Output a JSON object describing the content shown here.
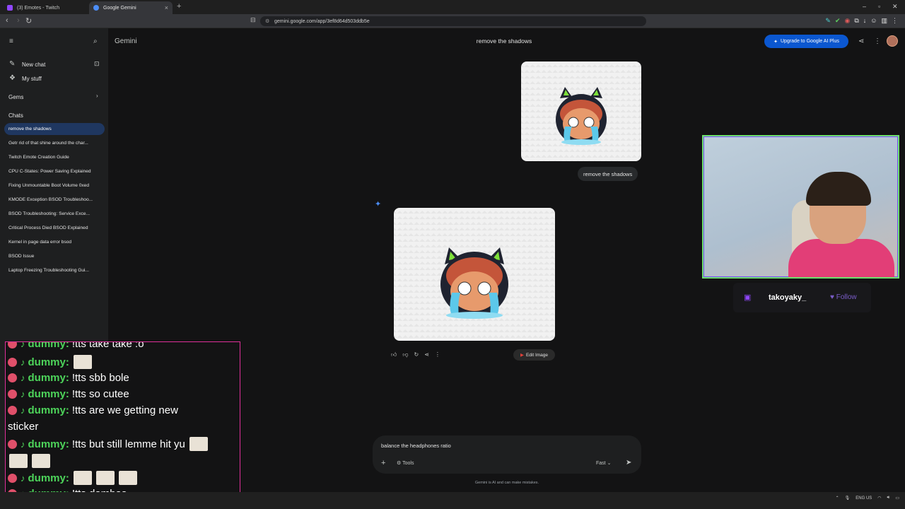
{
  "browser": {
    "tabs": [
      {
        "label": "(3) Emotes - Twitch",
        "active": false
      },
      {
        "label": "Google Gemini",
        "active": true
      }
    ],
    "url": "gemini.google.com/app/3ef8d64d503ddb5e"
  },
  "sidebar": {
    "new_chat": "New chat",
    "my_stuff": "My stuff",
    "gems": "Gems",
    "chats_heading": "Chats",
    "chats": [
      "remove the shadows",
      "Getr rid of that shine around the char...",
      "Twitch Emote Creation Guide",
      "CPU C-States: Power Saving Explained",
      "Fixing Unmountable Boot Volume 0xed",
      "KMODE Exception BSOD Troubleshoo...",
      "BSOD Troubleshooting: Service Exce...",
      "Critical Process Died BSOD Explained",
      "Kernel in page data error bsod",
      "BSOD Issue",
      "Laptop Freezing Troubleshooting Gui..."
    ]
  },
  "header": {
    "brand": "Gemini",
    "chat_title": "remove the shadows",
    "upgrade": "Upgrade to Google AI Plus"
  },
  "conversation": {
    "user_message": "remove the shadows",
    "edit_image": "Edit Image"
  },
  "composer": {
    "text": "balance the headphones ratio",
    "tools": "Tools",
    "mode": "Fast",
    "disclaimer": "Gemini is AI and can make mistakes."
  },
  "stream": {
    "channel": "takoyaky_",
    "follow": "Follow",
    "chat": [
      {
        "user": "dummy:",
        "text": "!tts take take :o"
      },
      {
        "user": "dummy:",
        "text": ""
      },
      {
        "user": "dummy:",
        "text": "!tts sbb bole"
      },
      {
        "user": "dummy:",
        "text": "!tts so cutee"
      },
      {
        "user": "dummy:",
        "text": "!tts are we getting new"
      },
      {
        "user": "",
        "text": "sticker"
      },
      {
        "user": "dummy:",
        "text": "!tts but still lemme hit yu"
      },
      {
        "user": "dummy:",
        "text": ""
      },
      {
        "user": "dummy:",
        "text": "!tts dambas"
      }
    ]
  },
  "taskbar": {
    "lang": "ENG",
    "region": "US"
  },
  "colors": {
    "accent": "#0b57d0",
    "twitch": "#9147ff",
    "chat_user": "#4dd45a",
    "chat_border": "#e0309a"
  }
}
